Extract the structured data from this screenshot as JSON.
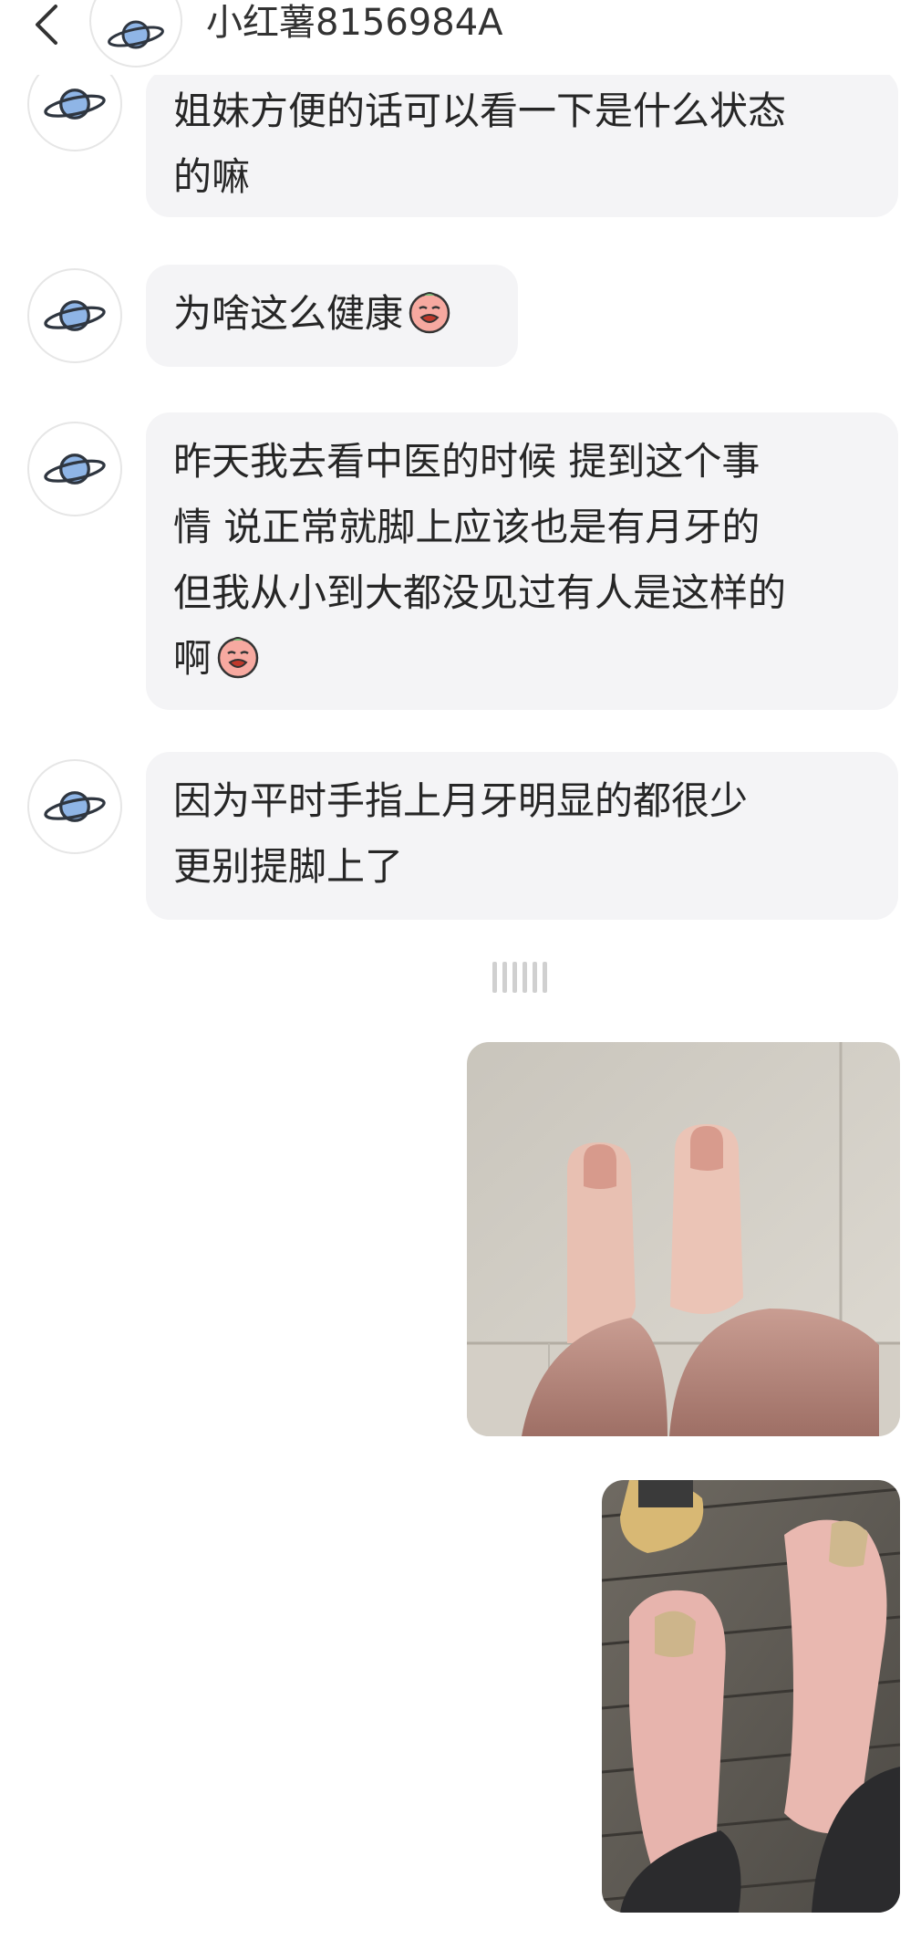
{
  "header": {
    "title": "小红薯8156984A",
    "back_icon": "chevron-left-icon",
    "avatar_icon": "planet-icon"
  },
  "messages": [
    {
      "lines": [
        "姐妹方便的话可以看一下是什么状态",
        "的嘛"
      ]
    },
    {
      "lines": [
        "为啥这么健康"
      ],
      "emoji": "crying-face-icon"
    },
    {
      "lines": [
        "昨天我去看中医的时候  提到这个事",
        "情  说正常就脚上应该也是有月牙的",
        "但我从小到大都没见过有人是这样的",
        "啊"
      ],
      "emoji": "crying-face-icon"
    },
    {
      "lines": [
        "因为平时手指上月牙明显的都很少",
        "更别提脚上了"
      ]
    }
  ],
  "photos": [
    {
      "subject": "photo-feet-on-tile-floor"
    },
    {
      "subject": "photo-feet-on-wooden-deck"
    }
  ],
  "colors": {
    "bubble_bg": "#f4f4f6",
    "avatar_planet": "#8fb5e6"
  }
}
